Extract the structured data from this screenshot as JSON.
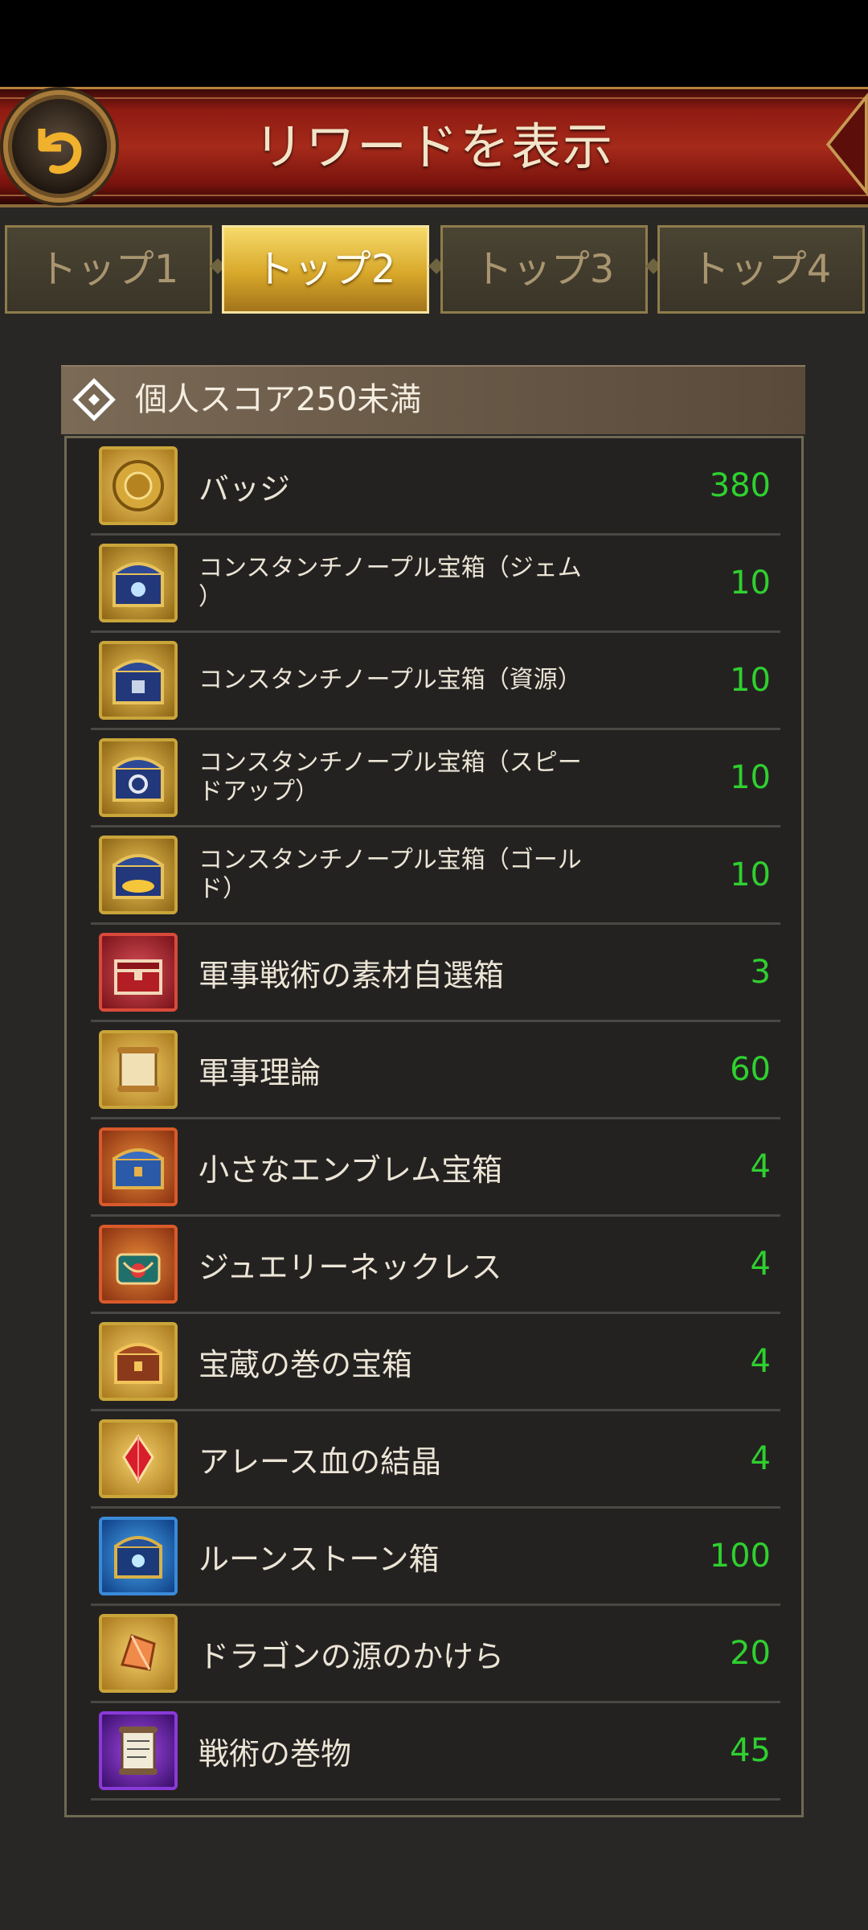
{
  "header": {
    "title": "リワードを表示"
  },
  "tabs": [
    {
      "label": "トップ1",
      "active": false
    },
    {
      "label": "トップ2",
      "active": true
    },
    {
      "label": "トップ3",
      "active": false
    },
    {
      "label": "トップ4",
      "active": false
    }
  ],
  "section": {
    "title": "個人スコア250未満"
  },
  "rewards": [
    {
      "name": "バッジ",
      "qty": "380",
      "icon": "badge-icon"
    },
    {
      "name": "コンスタンチノープル宝箱（ジェム\n）",
      "qty": "10",
      "icon": "gem-chest-icon"
    },
    {
      "name": "コンスタンチノープル宝箱（資源）",
      "qty": "10",
      "icon": "resource-chest-icon"
    },
    {
      "name": "コンスタンチノープル宝箱（スピー\nドアップ）",
      "qty": "10",
      "icon": "speedup-chest-icon"
    },
    {
      "name": "コンスタンチノープル宝箱（ゴール\nド）",
      "qty": "10",
      "icon": "gold-chest-icon"
    },
    {
      "name": "軍事戦術の素材自選箱",
      "qty": "3",
      "icon": "red-chest-icon"
    },
    {
      "name": "軍事理論",
      "qty": "60",
      "icon": "scroll-icon"
    },
    {
      "name": "小さなエンブレム宝箱",
      "qty": "4",
      "icon": "blue-chest-icon"
    },
    {
      "name": "ジュエリーネックレス",
      "qty": "4",
      "icon": "necklace-icon"
    },
    {
      "name": "宝蔵の巻の宝箱",
      "qty": "4",
      "icon": "treasure-chest-icon"
    },
    {
      "name": "アレース血の結晶",
      "qty": "4",
      "icon": "blood-crystal-icon"
    },
    {
      "name": "ルーンストーン箱",
      "qty": "100",
      "icon": "runestone-box-icon"
    },
    {
      "name": "ドラゴンの源のかけら",
      "qty": "20",
      "icon": "dragon-shard-icon"
    },
    {
      "name": "戦術の巻物",
      "qty": "45",
      "icon": "tactics-scroll-icon"
    }
  ]
}
